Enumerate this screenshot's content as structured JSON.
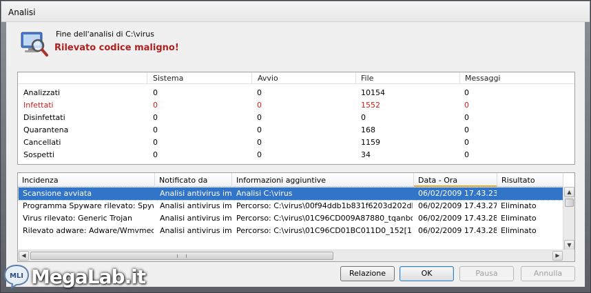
{
  "window": {
    "title": "Analisi"
  },
  "header": {
    "subtitle": "Fine dell'analisi di C:\\virus",
    "headline": "Rilevato codice maligno!"
  },
  "stats": {
    "columns": [
      "Sistema",
      "Avvio",
      "File",
      "Messaggi"
    ],
    "rows": [
      {
        "label": "Analizzati",
        "values": [
          "0",
          "0",
          "10154",
          "0"
        ]
      },
      {
        "label": "Infettati",
        "values": [
          "0",
          "0",
          "1552",
          "0"
        ]
      },
      {
        "label": "Disinfettati",
        "values": [
          "0",
          "0",
          "0",
          "0"
        ]
      },
      {
        "label": "Quarantena",
        "values": [
          "0",
          "0",
          "168",
          "0"
        ]
      },
      {
        "label": "Cancellati",
        "values": [
          "0",
          "0",
          "1159",
          "0"
        ]
      },
      {
        "label": "Sospetti",
        "values": [
          "0",
          "0",
          "34",
          "0"
        ]
      }
    ]
  },
  "log": {
    "columns": [
      "Incidenza",
      "Notificato da",
      "Informazioni aggiuntive",
      "Data - Ora",
      "Risultato"
    ],
    "rows": [
      [
        "Scansione avviata",
        "Analisi antivirus im...",
        "Analisi C:\\virus",
        "06/02/2009 17.43.23",
        ""
      ],
      [
        "Programma Spyware rilevato: Spyw...",
        "Analisi antivirus im...",
        "Percorso: C:\\virus\\00f94ddb1b831f6203d202db0...",
        "06/02/2009 17.43.27",
        "Eliminato"
      ],
      [
        "Virus rilevato: Generic Trojan",
        "Analisi antivirus im...",
        "Percorso: C:\\virus\\01C96CD009A87880_tqanboct...",
        "06/02/2009 17.43.28",
        "Eliminato"
      ],
      [
        "Rilevato adware: Adware/Wmvmedi...",
        "Analisi antivirus im...",
        "Percorso: C:\\virus\\01C96CD01BC011D0_152[1]_...",
        "06/02/2009 17.43.28",
        "Eliminato"
      ]
    ]
  },
  "buttons": {
    "report": "Relazione",
    "ok": "OK",
    "pause": "Pausa",
    "cancel": "Annulla"
  },
  "watermark": {
    "text": "MegaLab.it",
    "badge": "MLI"
  }
}
